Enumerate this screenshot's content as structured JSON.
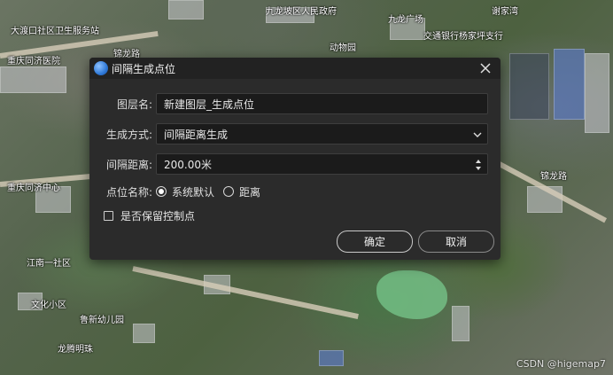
{
  "map": {
    "labels": [
      "九龙坡区人民政府",
      "大渡口社区卫生服务站",
      "重庆同济医院",
      "动物园",
      "九龙广场",
      "交通银行杨家坪支行",
      "谢家湾",
      "锦龙路",
      "锦龙路",
      "江南一社区",
      "鲁新幼儿园",
      "文化小区",
      "重庆同济中心",
      "龙腾明珠"
    ],
    "watermark": "CSDN @higemap7"
  },
  "dialog": {
    "title": "间隔生成点位",
    "layer_name_label": "图层名:",
    "layer_name_value": "新建图层_生成点位",
    "method_label": "生成方式:",
    "method_value": "间隔距离生成",
    "distance_label": "间隔距离:",
    "distance_value": "200.00米",
    "point_name_label": "点位名称:",
    "point_name_options": [
      "系统默认",
      "距离"
    ],
    "keep_control_points_label": "是否保留控制点",
    "ok_label": "确定",
    "cancel_label": "取消"
  }
}
